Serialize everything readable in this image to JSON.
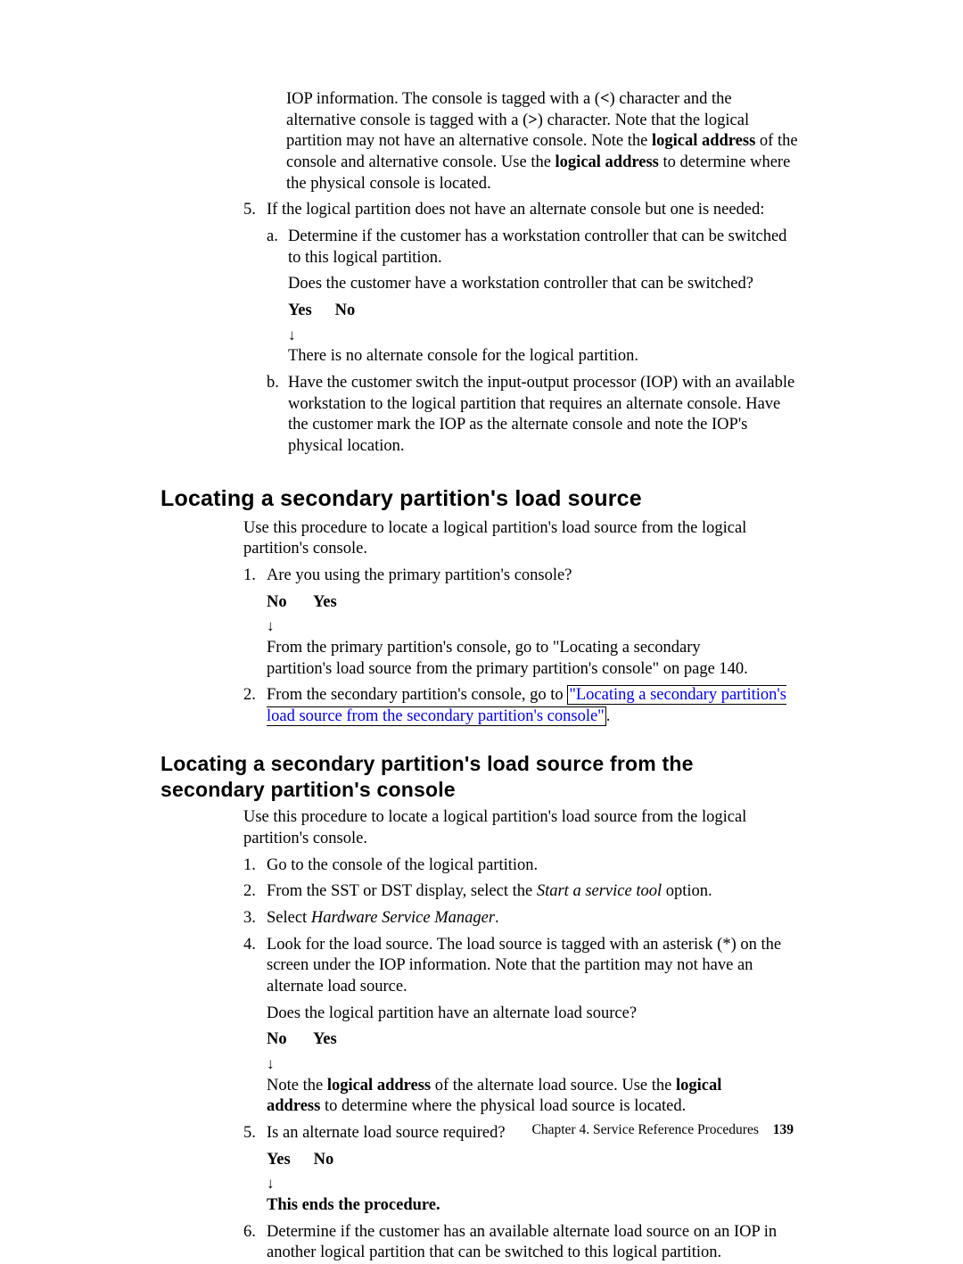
{
  "continuation": {
    "iop_paragraph_pre": "IOP information. The console is tagged with a (",
    "lt": "<",
    "iop_paragraph_mid1": ") character and the alternative console is tagged with a (",
    "gt": ">",
    "iop_paragraph_mid2": ") character. Note that the logical partition may not have an alternative console. Note the ",
    "bold_logical_address": "logical address",
    "iop_paragraph_mid3": " of the console and alternative console. Use the ",
    "iop_paragraph_end": " to determine where the physical console is located."
  },
  "step5": {
    "marker": "5.",
    "text": "If the logical partition does not have an alternate console but one is needed:",
    "a": {
      "marker": "a.",
      "line1": "Determine if the customer has a workstation controller that can be switched to this logical partition.",
      "question": "Does the customer have a workstation controller that can be switched?",
      "yes": "Yes",
      "no": "No",
      "arrow": "↓",
      "answer": "There is no alternate console for the logical partition."
    },
    "b": {
      "marker": "b.",
      "text": "Have the customer switch the input-output processor (IOP) with an available workstation to the logical partition that requires an alternate console. Have the customer mark the IOP as the alternate console and note the IOP's physical location."
    }
  },
  "section1": {
    "heading": "Locating a secondary partition's load source",
    "intro": "Use this procedure to locate a logical partition's load source from the logical partition's console.",
    "s1": {
      "marker": "1.",
      "question": "Are you using the primary partition's console?",
      "no": "No",
      "yes": "Yes",
      "arrow": "↓",
      "answer": "From the primary partition's console, go to \"Locating a secondary partition's load source from the primary partition's console\" on page 140."
    },
    "s2": {
      "marker": "2.",
      "pre": "From the secondary partition's console, go to ",
      "link": "\"Locating a secondary partition's load source from the secondary partition's console\"",
      "post": "."
    }
  },
  "section2": {
    "heading": "Locating a secondary partition's load source from the secondary partition's console",
    "intro": "Use this procedure to locate a logical partition's load source from the logical partition's console.",
    "s1": {
      "marker": "1.",
      "text": "Go to the console of the logical partition."
    },
    "s2": {
      "marker": "2.",
      "pre": "From the SST or DST display, select the ",
      "it": "Start a service tool",
      "post": " option."
    },
    "s3": {
      "marker": "3.",
      "pre": "Select ",
      "it": "Hardware Service Manager",
      "post": "."
    },
    "s4": {
      "marker": "4.",
      "para": "Look for the load source. The load source is tagged with an asterisk (*) on the screen under the IOP information. Note that the partition may not have an alternate load source.",
      "question": "Does the logical partition have an alternate load source?",
      "no": "No",
      "yes": "Yes",
      "arrow": "↓",
      "ans_pre": "Note the ",
      "ans_b1": "logical address",
      "ans_mid": " of the alternate load source. Use the ",
      "ans_b2": "logical address",
      "ans_post": " to determine where the physical load source is located."
    },
    "s5": {
      "marker": "5.",
      "question": "Is an alternate load source required?",
      "yes": "Yes",
      "no": "No",
      "arrow": "↓",
      "answer": "This ends the procedure."
    },
    "s6": {
      "marker": "6.",
      "text": "Determine if the customer has an available alternate load source on an IOP in another logical partition that can be switched to this logical partition."
    }
  },
  "footer": {
    "chapter": "Chapter 4. Service Reference Procedures",
    "page": "139"
  }
}
